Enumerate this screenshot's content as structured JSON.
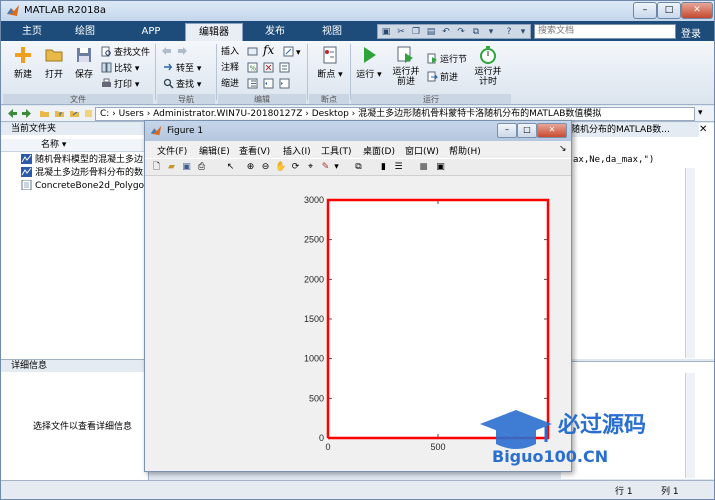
{
  "app": {
    "title": "MATLAB R2018a",
    "search_placeholder": "搜索文档",
    "login": "登录"
  },
  "tabs": [
    "主页",
    "绘图",
    "APP",
    "编辑器",
    "发布",
    "视图"
  ],
  "ribbon": {
    "file": {
      "new": "新建",
      "open": "打开",
      "save": "保存",
      "find_files": "查找文件",
      "compare": "比较",
      "print": "打印",
      "group": "文件"
    },
    "nav": {
      "goto": "转至",
      "find": "查找",
      "group": "导航"
    },
    "edit": {
      "insert": "插入",
      "comment": "注释",
      "indent": "缩进",
      "fx": "fx",
      "group": "编辑"
    },
    "breakpoints": {
      "label": "断点",
      "group": "断点"
    },
    "run": {
      "run": "运行",
      "run_advance_1": "运行并",
      "run_advance_2": "前进",
      "run_section": "运行节",
      "advance": "前进",
      "run_time_1": "运行并",
      "run_time_2": "计时",
      "group": "运行"
    }
  },
  "address": {
    "path": "C: › Users › Administrator.WIN7U-20180127Z › Desktop › 混凝土多边形随机骨料蒙特卡洛随机分布的MATLAB数值模拟"
  },
  "left_panel": {
    "title": "当前文件夹",
    "column": "名称",
    "files": [
      "随机骨料模型的混凝土多边",
      "混凝土多边形骨料分布的数",
      "ConcreteBone2d_Polygon"
    ],
    "detail_title": "详细信息",
    "detail_msg": "选择文件以查看详细信息"
  },
  "editor": {
    "tab": "随机分布的MATLAB数...",
    "code": "ax,Ne,da_max,\")"
  },
  "status": {
    "row": "行 1",
    "col": "列 1"
  },
  "figure": {
    "title": "Figure 1",
    "menus": [
      "文件(F)",
      "编辑(E)",
      "查看(V)",
      "插入(I)",
      "工具(T)",
      "桌面(D)",
      "窗口(W)",
      "帮助(H)"
    ]
  },
  "chart_data": {
    "type": "line",
    "series": [
      {
        "x": [
          0,
          0,
          1000,
          1000,
          0
        ],
        "y": [
          0,
          3000,
          3000,
          0,
          0
        ]
      }
    ],
    "xlim": [
      0,
      1000
    ],
    "ylim": [
      0,
      3000
    ],
    "xticks": [
      0,
      500
    ],
    "yticks": [
      0,
      500,
      1000,
      1500,
      2000,
      2500,
      3000
    ],
    "xlabel": "",
    "ylabel": "",
    "title": "",
    "grid": false,
    "color": "#ff0000"
  },
  "watermark": {
    "line1": "必过源码",
    "line2": "Biguo100.CN"
  },
  "colors": {
    "accent": "#1d4b7a",
    "series": "#ff0000"
  }
}
